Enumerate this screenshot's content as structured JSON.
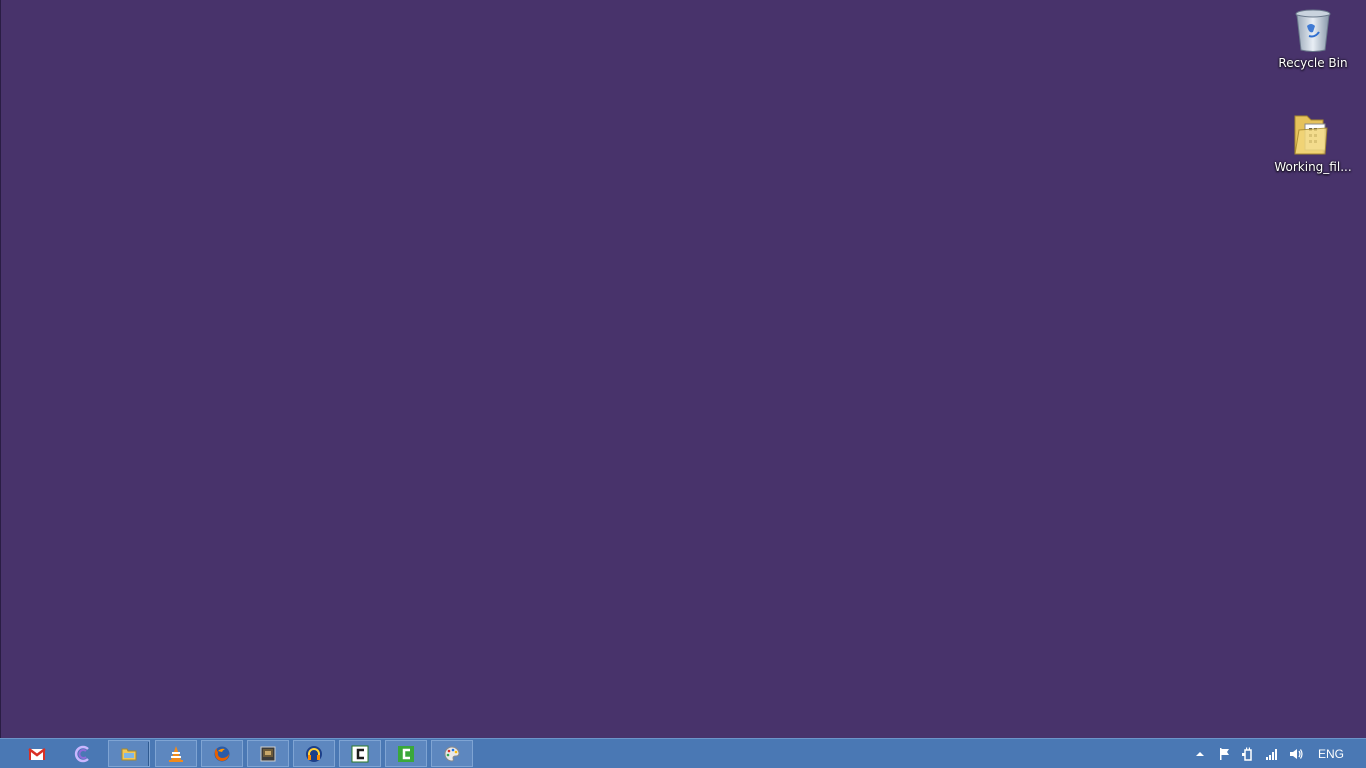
{
  "desktop": {
    "background_color": "#48336b",
    "icons": [
      {
        "label": "Recycle Bin",
        "icon": "recycle-bin-icon"
      },
      {
        "label": "Working_fil...",
        "icon": "folder-icon"
      }
    ]
  },
  "taskbar": {
    "background_color": "#4a78b4",
    "items": [
      {
        "name": "gmail",
        "icon": "mail-icon",
        "running": false
      },
      {
        "name": "browser",
        "icon": "browser-icon",
        "running": false
      },
      {
        "name": "file-explorer",
        "icon": "folder-icon",
        "running": true
      },
      {
        "name": "vlc",
        "icon": "vlc-cone-icon",
        "running": true
      },
      {
        "name": "firefox",
        "icon": "firefox-icon",
        "running": true
      },
      {
        "name": "app-window",
        "icon": "app-window-icon",
        "running": true
      },
      {
        "name": "audio-app",
        "icon": "headphones-icon",
        "running": true
      },
      {
        "name": "camtasia-1",
        "icon": "camtasia-icon",
        "running": true
      },
      {
        "name": "camtasia-2",
        "icon": "camtasia-green-icon",
        "running": true
      },
      {
        "name": "paint",
        "icon": "paint-palette-icon",
        "running": true
      }
    ],
    "tray": {
      "icons": [
        "show-hidden-icons-arrow",
        "action-center-flag-icon",
        "power-icon",
        "network-signal-icon",
        "volume-icon"
      ],
      "language": "ENG"
    }
  }
}
